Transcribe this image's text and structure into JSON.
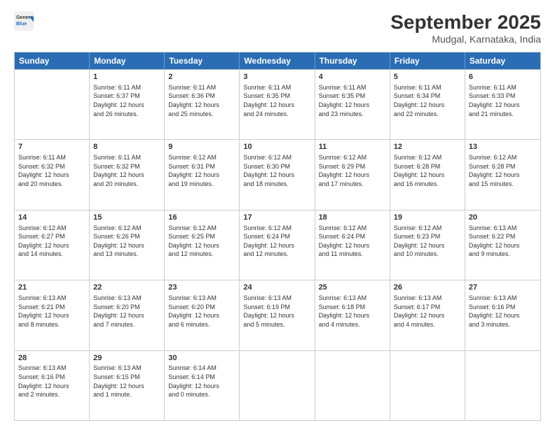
{
  "logo": {
    "line1": "General",
    "line2": "Blue"
  },
  "title": "September 2025",
  "location": "Mudgal, Karnataka, India",
  "header_days": [
    "Sunday",
    "Monday",
    "Tuesday",
    "Wednesday",
    "Thursday",
    "Friday",
    "Saturday"
  ],
  "weeks": [
    [
      {
        "day": "",
        "info": ""
      },
      {
        "day": "1",
        "info": "Sunrise: 6:11 AM\nSunset: 6:37 PM\nDaylight: 12 hours\nand 26 minutes."
      },
      {
        "day": "2",
        "info": "Sunrise: 6:11 AM\nSunset: 6:36 PM\nDaylight: 12 hours\nand 25 minutes."
      },
      {
        "day": "3",
        "info": "Sunrise: 6:11 AM\nSunset: 6:35 PM\nDaylight: 12 hours\nand 24 minutes."
      },
      {
        "day": "4",
        "info": "Sunrise: 6:11 AM\nSunset: 6:35 PM\nDaylight: 12 hours\nand 23 minutes."
      },
      {
        "day": "5",
        "info": "Sunrise: 6:11 AM\nSunset: 6:34 PM\nDaylight: 12 hours\nand 22 minutes."
      },
      {
        "day": "6",
        "info": "Sunrise: 6:11 AM\nSunset: 6:33 PM\nDaylight: 12 hours\nand 21 minutes."
      }
    ],
    [
      {
        "day": "7",
        "info": "Sunrise: 6:11 AM\nSunset: 6:32 PM\nDaylight: 12 hours\nand 20 minutes."
      },
      {
        "day": "8",
        "info": "Sunrise: 6:11 AM\nSunset: 6:32 PM\nDaylight: 12 hours\nand 20 minutes."
      },
      {
        "day": "9",
        "info": "Sunrise: 6:12 AM\nSunset: 6:31 PM\nDaylight: 12 hours\nand 19 minutes."
      },
      {
        "day": "10",
        "info": "Sunrise: 6:12 AM\nSunset: 6:30 PM\nDaylight: 12 hours\nand 18 minutes."
      },
      {
        "day": "11",
        "info": "Sunrise: 6:12 AM\nSunset: 6:29 PM\nDaylight: 12 hours\nand 17 minutes."
      },
      {
        "day": "12",
        "info": "Sunrise: 6:12 AM\nSunset: 6:28 PM\nDaylight: 12 hours\nand 16 minutes."
      },
      {
        "day": "13",
        "info": "Sunrise: 6:12 AM\nSunset: 6:28 PM\nDaylight: 12 hours\nand 15 minutes."
      }
    ],
    [
      {
        "day": "14",
        "info": "Sunrise: 6:12 AM\nSunset: 6:27 PM\nDaylight: 12 hours\nand 14 minutes."
      },
      {
        "day": "15",
        "info": "Sunrise: 6:12 AM\nSunset: 6:26 PM\nDaylight: 12 hours\nand 13 minutes."
      },
      {
        "day": "16",
        "info": "Sunrise: 6:12 AM\nSunset: 6:25 PM\nDaylight: 12 hours\nand 12 minutes."
      },
      {
        "day": "17",
        "info": "Sunrise: 6:12 AM\nSunset: 6:24 PM\nDaylight: 12 hours\nand 12 minutes."
      },
      {
        "day": "18",
        "info": "Sunrise: 6:12 AM\nSunset: 6:24 PM\nDaylight: 12 hours\nand 11 minutes."
      },
      {
        "day": "19",
        "info": "Sunrise: 6:12 AM\nSunset: 6:23 PM\nDaylight: 12 hours\nand 10 minutes."
      },
      {
        "day": "20",
        "info": "Sunrise: 6:13 AM\nSunset: 6:22 PM\nDaylight: 12 hours\nand 9 minutes."
      }
    ],
    [
      {
        "day": "21",
        "info": "Sunrise: 6:13 AM\nSunset: 6:21 PM\nDaylight: 12 hours\nand 8 minutes."
      },
      {
        "day": "22",
        "info": "Sunrise: 6:13 AM\nSunset: 6:20 PM\nDaylight: 12 hours\nand 7 minutes."
      },
      {
        "day": "23",
        "info": "Sunrise: 6:13 AM\nSunset: 6:20 PM\nDaylight: 12 hours\nand 6 minutes."
      },
      {
        "day": "24",
        "info": "Sunrise: 6:13 AM\nSunset: 6:19 PM\nDaylight: 12 hours\nand 5 minutes."
      },
      {
        "day": "25",
        "info": "Sunrise: 6:13 AM\nSunset: 6:18 PM\nDaylight: 12 hours\nand 4 minutes."
      },
      {
        "day": "26",
        "info": "Sunrise: 6:13 AM\nSunset: 6:17 PM\nDaylight: 12 hours\nand 4 minutes."
      },
      {
        "day": "27",
        "info": "Sunrise: 6:13 AM\nSunset: 6:16 PM\nDaylight: 12 hours\nand 3 minutes."
      }
    ],
    [
      {
        "day": "28",
        "info": "Sunrise: 6:13 AM\nSunset: 6:16 PM\nDaylight: 12 hours\nand 2 minutes."
      },
      {
        "day": "29",
        "info": "Sunrise: 6:13 AM\nSunset: 6:15 PM\nDaylight: 12 hours\nand 1 minute."
      },
      {
        "day": "30",
        "info": "Sunrise: 6:14 AM\nSunset: 6:14 PM\nDaylight: 12 hours\nand 0 minutes."
      },
      {
        "day": "",
        "info": ""
      },
      {
        "day": "",
        "info": ""
      },
      {
        "day": "",
        "info": ""
      },
      {
        "day": "",
        "info": ""
      }
    ]
  ]
}
